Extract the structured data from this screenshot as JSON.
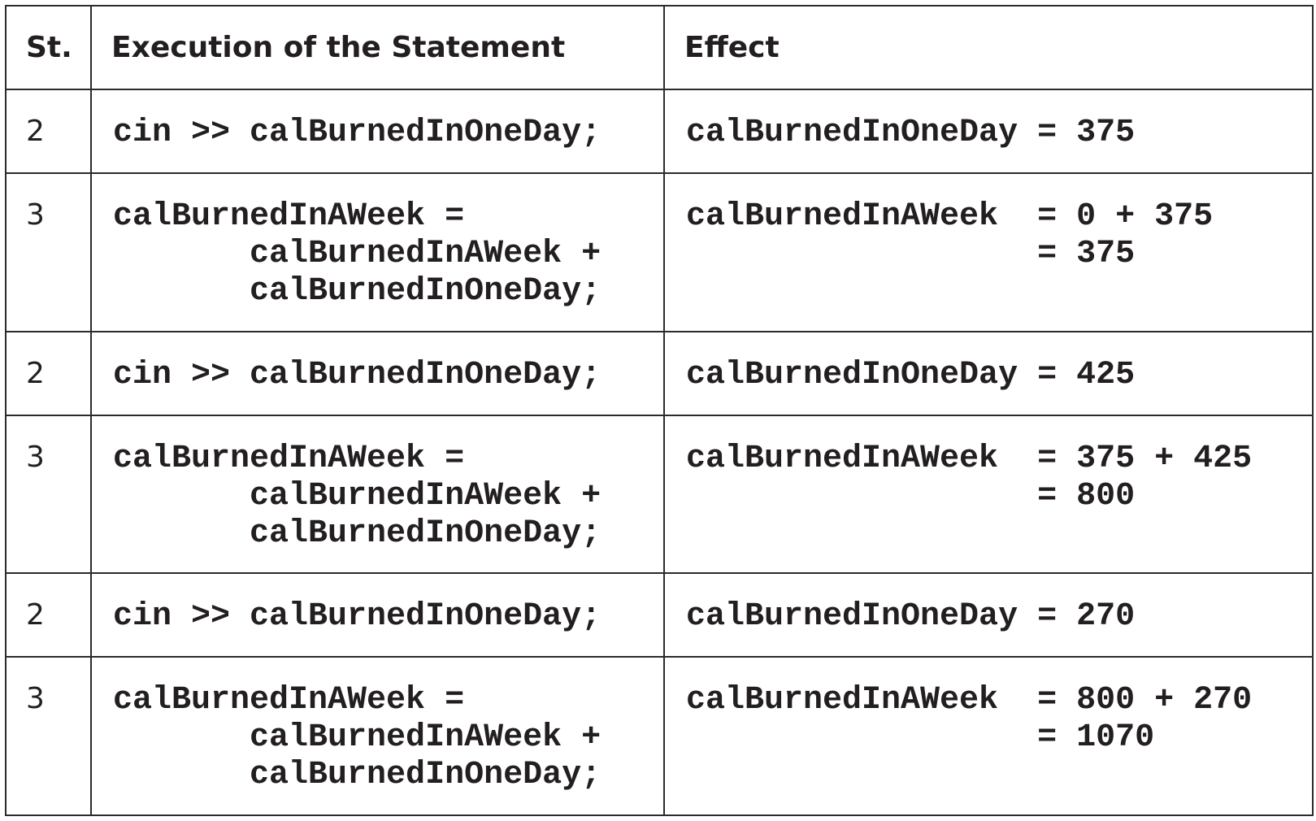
{
  "header": {
    "col_st": "St.",
    "col_exec": "Execution of the Statement",
    "col_effect": "Effect"
  },
  "rows": [
    {
      "st": "2",
      "exec": "cin >> calBurnedInOneDay;",
      "effect": "calBurnedInOneDay = 375"
    },
    {
      "st": "3",
      "exec": "calBurnedInAWeek =\n       calBurnedInAWeek +\n       calBurnedInOneDay;",
      "effect": "calBurnedInAWeek  = 0 + 375\n                  = 375"
    },
    {
      "st": "2",
      "exec": "cin >> calBurnedInOneDay;",
      "effect": "calBurnedInOneDay = 425"
    },
    {
      "st": "3",
      "exec": "calBurnedInAWeek =\n       calBurnedInAWeek +\n       calBurnedInOneDay;",
      "effect": "calBurnedInAWeek  = 375 + 425\n                  = 800"
    },
    {
      "st": "2",
      "exec": "cin >> calBurnedInOneDay;",
      "effect": "calBurnedInOneDay = 270"
    },
    {
      "st": "3",
      "exec": "calBurnedInAWeek =\n       calBurnedInAWeek +\n       calBurnedInOneDay;",
      "effect": "calBurnedInAWeek  = 800 + 270\n                  = 1070"
    }
  ]
}
